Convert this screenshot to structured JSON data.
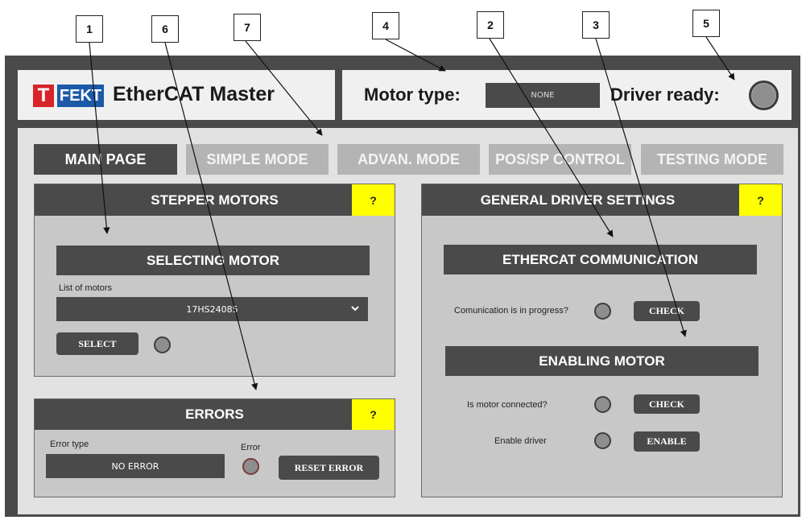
{
  "callouts": [
    "1",
    "6",
    "7",
    "4",
    "2",
    "3",
    "5"
  ],
  "header": {
    "logo_t": "T",
    "logo_fekt": "FEKT",
    "app_title": "EtherCAT Master",
    "motor_type_label": "Motor type:",
    "motor_type_value": "NONE",
    "driver_ready_label": "Driver ready:"
  },
  "tabs": [
    {
      "label": "MAIN PAGE"
    },
    {
      "label": "SIMPLE MODE"
    },
    {
      "label": "ADVAN. MODE"
    },
    {
      "label": "POS/SP CONTROL"
    },
    {
      "label": "TESTING MODE"
    }
  ],
  "stepper": {
    "title": "STEPPER MOTORS",
    "help": "?",
    "section": "SELECTING MOTOR",
    "list_label": "List of motors",
    "selected_motor": "17HS24085",
    "select_button": "SELECT"
  },
  "errors": {
    "title": "ERRORS",
    "help": "?",
    "error_type_label": "Error type",
    "error_type_value": "NO ERROR",
    "error_label": "Error",
    "reset_button": "RESET ERROR"
  },
  "general": {
    "title": "GENERAL DRIVER SETTINGS",
    "help": "?",
    "ethercat_section": "ETHERCAT COMMUNICATION",
    "comm_label": "Comunication is in progress?",
    "comm_check": "CHECK",
    "enabling_section": "ENABLING MOTOR",
    "connected_label": "Is motor connected?",
    "connected_check": "CHECK",
    "enable_label": "Enable driver",
    "enable_button": "ENABLE"
  },
  "colors": {
    "dark": "#4a4a4a",
    "help_yellow": "#ffff00",
    "logo_red": "#d8232a",
    "logo_blue": "#1c5aa8"
  }
}
